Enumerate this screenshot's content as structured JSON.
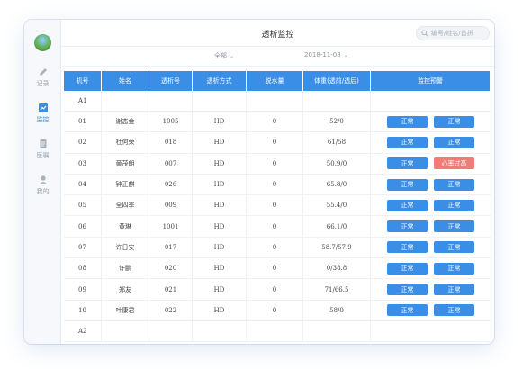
{
  "app": {
    "title": "透析监控",
    "search_placeholder": "编号/姓名/首拼"
  },
  "sidebar": {
    "items": [
      {
        "label": "记录",
        "icon": "pencil-icon",
        "active": false
      },
      {
        "label": "监控",
        "icon": "chart-line-icon",
        "active": true
      },
      {
        "label": "医嘱",
        "icon": "document-icon",
        "active": false
      },
      {
        "label": "我的",
        "icon": "user-icon",
        "active": false
      }
    ]
  },
  "filters": {
    "scope": "全部",
    "date": "2018-11-08"
  },
  "colors": {
    "accent": "#3a8ee6",
    "alert": "#f07b77"
  },
  "table": {
    "headers": [
      "机号",
      "姓名",
      "透析号",
      "透析方式",
      "脱水量",
      "体重(透前/透后)",
      "监控预警"
    ],
    "group_a": "A1",
    "group_b": "A2",
    "rows": [
      {
        "no": "01",
        "name": "谢态金",
        "id": "1005",
        "mode": "HD",
        "uf": "0",
        "weight": "52/0",
        "w1": "正常",
        "w2": "正常",
        "alert": false
      },
      {
        "no": "02",
        "name": "杜何荣",
        "id": "018",
        "mode": "HD",
        "uf": "0",
        "weight": "61/58",
        "w1": "正常",
        "w2": "正常",
        "alert": false
      },
      {
        "no": "03",
        "name": "黄茂朗",
        "id": "007",
        "mode": "HD",
        "uf": "0",
        "weight": "50.9/0",
        "w1": "正常",
        "w2": "心率过高",
        "alert": true
      },
      {
        "no": "04",
        "name": "钟正麒",
        "id": "026",
        "mode": "HD",
        "uf": "0",
        "weight": "65.8/0",
        "w1": "正常",
        "w2": "正常",
        "alert": false
      },
      {
        "no": "05",
        "name": "全四季",
        "id": "009",
        "mode": "HD",
        "uf": "0",
        "weight": "55.4/0",
        "w1": "正常",
        "w2": "正常",
        "alert": false
      },
      {
        "no": "06",
        "name": "黄琳",
        "id": "1001",
        "mode": "HD",
        "uf": "0",
        "weight": "66.1/0",
        "w1": "正常",
        "w2": "正常",
        "alert": false
      },
      {
        "no": "07",
        "name": "许日安",
        "id": "017",
        "mode": "HD",
        "uf": "0",
        "weight": "58.7/57.9",
        "w1": "正常",
        "w2": "正常",
        "alert": false
      },
      {
        "no": "08",
        "name": "许鹏",
        "id": "020",
        "mode": "HD",
        "uf": "0",
        "weight": "0/38.8",
        "w1": "正常",
        "w2": "正常",
        "alert": false
      },
      {
        "no": "09",
        "name": "郑友",
        "id": "021",
        "mode": "HD",
        "uf": "0",
        "weight": "71/66.5",
        "w1": "正常",
        "w2": "正常",
        "alert": false
      },
      {
        "no": "10",
        "name": "叶康君",
        "id": "022",
        "mode": "HD",
        "uf": "0",
        "weight": "58/0",
        "w1": "正常",
        "w2": "正常",
        "alert": false
      }
    ]
  }
}
